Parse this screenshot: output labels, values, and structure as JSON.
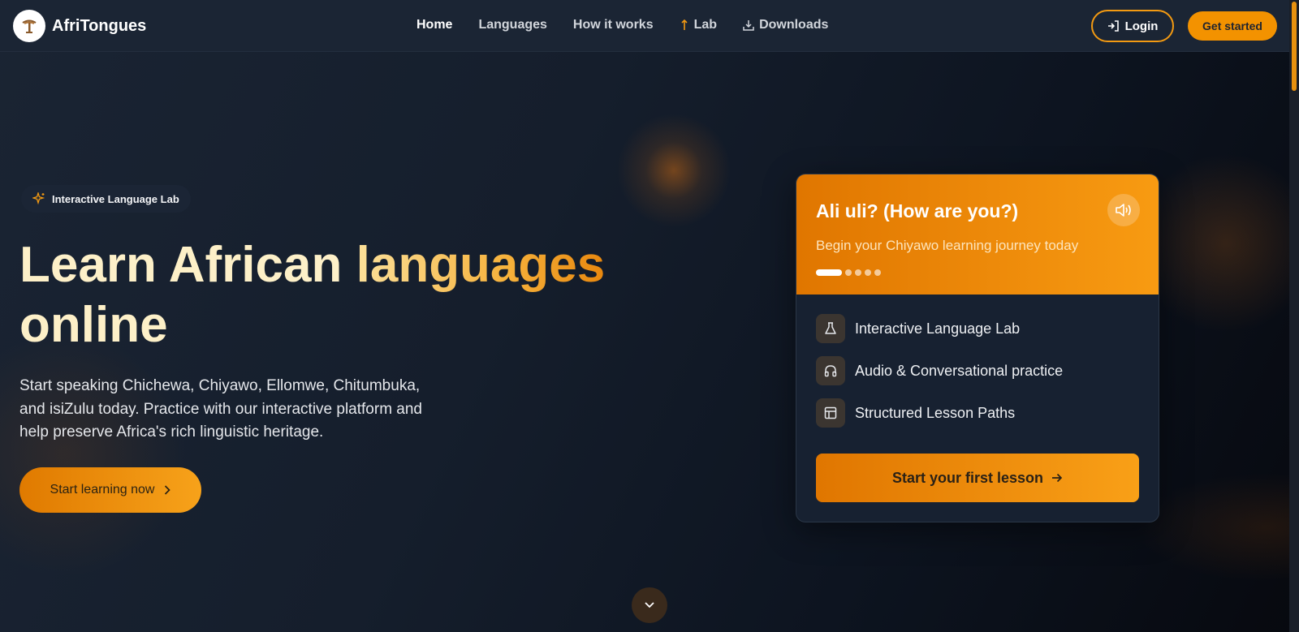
{
  "brand": {
    "name": "AfriTongues"
  },
  "nav": {
    "items": [
      {
        "label": "Home",
        "active": true
      },
      {
        "label": "Languages"
      },
      {
        "label": "How it works"
      },
      {
        "label": "Lab",
        "icon": "flask-icon"
      },
      {
        "label": "Downloads",
        "icon": "download-icon"
      }
    ]
  },
  "header": {
    "login_label": "Login",
    "get_started_label": "Get started"
  },
  "hero": {
    "pill_label": "Interactive Language Lab",
    "title_part1": "Learn African ",
    "title_highlight": "languages",
    "title_part2": "online",
    "description": "Start speaking Chichewa, Chiyawo, Ellomwe, Chitumbuka, and isiZulu today. Practice with our interactive platform and help preserve Africa's rich linguistic heritage.",
    "cta_label": "Start learning now"
  },
  "card": {
    "title": "Ali uli? (How are you?)",
    "subtitle": "Begin your Chiyawo learning journey today",
    "slide_count": 5,
    "active_slide": 1,
    "features": [
      {
        "label": "Interactive Language Lab",
        "icon": "flask-icon"
      },
      {
        "label": "Audio & Conversational practice",
        "icon": "headphones-icon"
      },
      {
        "label": "Structured Lesson Paths",
        "icon": "layout-icon"
      }
    ],
    "cta_label": "Start your first lesson"
  },
  "colors": {
    "accent": "#f39200",
    "accent_dark": "#e07600",
    "background": "#111a27"
  }
}
